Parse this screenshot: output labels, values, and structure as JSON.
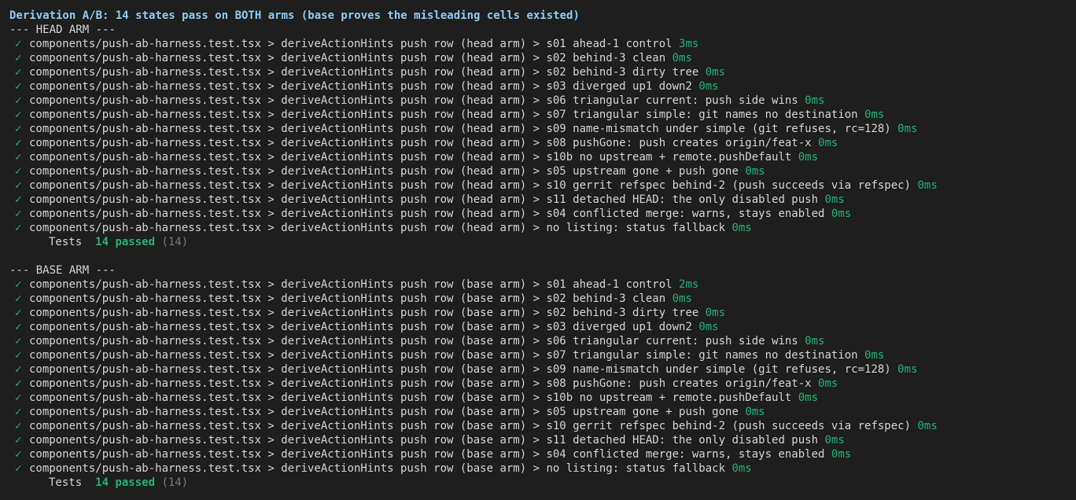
{
  "title": "Derivation A/B: 14 states pass on BOTH arms (base proves the misleading cells existed)",
  "check_glyph": "✓",
  "colors": {
    "background": "#1e1e1e",
    "text": "#d4d4d4",
    "title": "#8fcbf0",
    "pass": "#23b17a",
    "muted": "#7a7a7a"
  },
  "head": {
    "header": "--- HEAD ARM ---",
    "tests": [
      {
        "text": "components/push-ab-harness.test.tsx > deriveActionHints push row (head arm) > s01 ahead-1 control",
        "duration": "3ms"
      },
      {
        "text": "components/push-ab-harness.test.tsx > deriveActionHints push row (head arm) > s02 behind-3 clean",
        "duration": "0ms"
      },
      {
        "text": "components/push-ab-harness.test.tsx > deriveActionHints push row (head arm) > s02 behind-3 dirty tree",
        "duration": "0ms"
      },
      {
        "text": "components/push-ab-harness.test.tsx > deriveActionHints push row (head arm) > s03 diverged up1 down2",
        "duration": "0ms"
      },
      {
        "text": "components/push-ab-harness.test.tsx > deriveActionHints push row (head arm) > s06 triangular current: push side wins",
        "duration": "0ms"
      },
      {
        "text": "components/push-ab-harness.test.tsx > deriveActionHints push row (head arm) > s07 triangular simple: git names no destination",
        "duration": "0ms"
      },
      {
        "text": "components/push-ab-harness.test.tsx > deriveActionHints push row (head arm) > s09 name-mismatch under simple (git refuses, rc=128)",
        "duration": "0ms"
      },
      {
        "text": "components/push-ab-harness.test.tsx > deriveActionHints push row (head arm) > s08 pushGone: push creates origin/feat-x",
        "duration": "0ms"
      },
      {
        "text": "components/push-ab-harness.test.tsx > deriveActionHints push row (head arm) > s10b no upstream + remote.pushDefault",
        "duration": "0ms"
      },
      {
        "text": "components/push-ab-harness.test.tsx > deriveActionHints push row (head arm) > s05 upstream gone + push gone",
        "duration": "0ms"
      },
      {
        "text": "components/push-ab-harness.test.tsx > deriveActionHints push row (head arm) > s10 gerrit refspec behind-2 (push succeeds via refspec)",
        "duration": "0ms"
      },
      {
        "text": "components/push-ab-harness.test.tsx > deriveActionHints push row (head arm) > s11 detached HEAD: the only disabled push",
        "duration": "0ms"
      },
      {
        "text": "components/push-ab-harness.test.tsx > deriveActionHints push row (head arm) > s04 conflicted merge: warns, stays enabled",
        "duration": "0ms"
      },
      {
        "text": "components/push-ab-harness.test.tsx > deriveActionHints push row (head arm) > no listing: status fallback",
        "duration": "0ms"
      }
    ],
    "summary": {
      "label": "Tests",
      "passed": "14 passed",
      "count": "(14)"
    }
  },
  "base": {
    "header": "--- BASE ARM ---",
    "tests": [
      {
        "text": "components/push-ab-harness.test.tsx > deriveActionHints push row (base arm) > s01 ahead-1 control",
        "duration": "2ms"
      },
      {
        "text": "components/push-ab-harness.test.tsx > deriveActionHints push row (base arm) > s02 behind-3 clean",
        "duration": "0ms"
      },
      {
        "text": "components/push-ab-harness.test.tsx > deriveActionHints push row (base arm) > s02 behind-3 dirty tree",
        "duration": "0ms"
      },
      {
        "text": "components/push-ab-harness.test.tsx > deriveActionHints push row (base arm) > s03 diverged up1 down2",
        "duration": "0ms"
      },
      {
        "text": "components/push-ab-harness.test.tsx > deriveActionHints push row (base arm) > s06 triangular current: push side wins",
        "duration": "0ms"
      },
      {
        "text": "components/push-ab-harness.test.tsx > deriveActionHints push row (base arm) > s07 triangular simple: git names no destination",
        "duration": "0ms"
      },
      {
        "text": "components/push-ab-harness.test.tsx > deriveActionHints push row (base arm) > s09 name-mismatch under simple (git refuses, rc=128)",
        "duration": "0ms"
      },
      {
        "text": "components/push-ab-harness.test.tsx > deriveActionHints push row (base arm) > s08 pushGone: push creates origin/feat-x",
        "duration": "0ms"
      },
      {
        "text": "components/push-ab-harness.test.tsx > deriveActionHints push row (base arm) > s10b no upstream + remote.pushDefault",
        "duration": "0ms"
      },
      {
        "text": "components/push-ab-harness.test.tsx > deriveActionHints push row (base arm) > s05 upstream gone + push gone",
        "duration": "0ms"
      },
      {
        "text": "components/push-ab-harness.test.tsx > deriveActionHints push row (base arm) > s10 gerrit refspec behind-2 (push succeeds via refspec)",
        "duration": "0ms"
      },
      {
        "text": "components/push-ab-harness.test.tsx > deriveActionHints push row (base arm) > s11 detached HEAD: the only disabled push",
        "duration": "0ms"
      },
      {
        "text": "components/push-ab-harness.test.tsx > deriveActionHints push row (base arm) > s04 conflicted merge: warns, stays enabled",
        "duration": "0ms"
      },
      {
        "text": "components/push-ab-harness.test.tsx > deriveActionHints push row (base arm) > no listing: status fallback",
        "duration": "0ms"
      }
    ],
    "summary": {
      "label": "Tests",
      "passed": "14 passed",
      "count": "(14)"
    }
  }
}
